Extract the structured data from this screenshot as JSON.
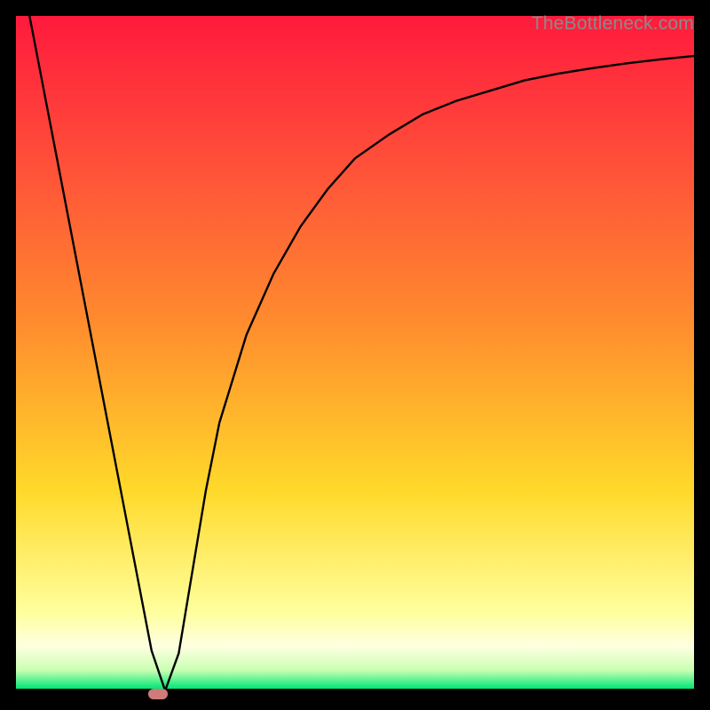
{
  "watermark": "TheBottleneck.com",
  "colors": {
    "top": "#ff1a3c",
    "mid_red": "#ff4b3a",
    "orange": "#ff8b2e",
    "yellow": "#ffd92a",
    "pale_yellow": "#ffff9e",
    "very_pale": "#fdffe0",
    "green_pale": "#c9ffb2",
    "green": "#00e676",
    "black": "#000000",
    "curve": "#000000",
    "marker": "#cf7a7b"
  },
  "chart_data": {
    "type": "line",
    "title": "",
    "xlabel": "",
    "ylabel": "",
    "xlim": [
      0,
      100
    ],
    "ylim": [
      0,
      100
    ],
    "series": [
      {
        "name": "bottleneck-curve",
        "x": [
          2,
          4,
          6,
          8,
          10,
          12,
          14,
          16,
          18,
          20,
          22,
          24,
          26,
          28,
          30,
          34,
          38,
          42,
          46,
          50,
          55,
          60,
          65,
          70,
          75,
          80,
          85,
          90,
          95,
          100
        ],
        "y": [
          100,
          89.6,
          79.2,
          68.8,
          58.4,
          48.0,
          37.6,
          27.2,
          16.8,
          6.4,
          0.5,
          6.0,
          18.0,
          30.0,
          40.0,
          53.0,
          62.0,
          69.0,
          74.5,
          79.0,
          82.5,
          85.5,
          87.5,
          89.0,
          90.5,
          91.5,
          92.3,
          93.0,
          93.6,
          94.1
        ]
      }
    ],
    "marker": {
      "x": 21,
      "y": 0
    },
    "gradient_stops": [
      {
        "pct": 0,
        "color_key": "top"
      },
      {
        "pct": 20,
        "color_key": "mid_red"
      },
      {
        "pct": 45,
        "color_key": "orange"
      },
      {
        "pct": 70,
        "color_key": "yellow"
      },
      {
        "pct": 88,
        "color_key": "pale_yellow"
      },
      {
        "pct": 93,
        "color_key": "very_pale"
      },
      {
        "pct": 96.5,
        "color_key": "green_pale"
      },
      {
        "pct": 99.2,
        "color_key": "green"
      },
      {
        "pct": 99.2,
        "color_key": "black"
      },
      {
        "pct": 100,
        "color_key": "black"
      }
    ]
  }
}
